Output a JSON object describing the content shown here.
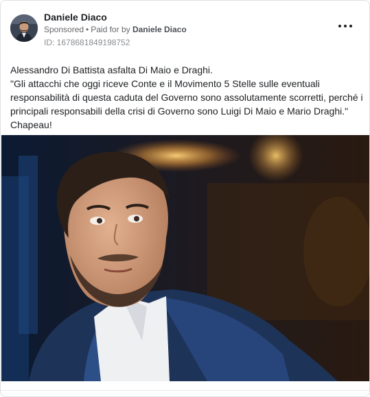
{
  "post": {
    "author": "Daniele Diaco",
    "sponsored_label": "Sponsored",
    "paid_for_prefix": "Paid for by",
    "paid_for_name": "Daniele Diaco",
    "ad_id": "ID: 1678681849198752",
    "text_lines": [
      "Alessandro Di Battista asfalta Di Maio e Draghi.",
      "\"Gli attacchi che oggi riceve Conte e il Movimento 5 Stelle sulle eventuali responsabilità di questa caduta del Governo sono assolutamente scorretti, perché i principali responsabili della crisi di Governo sono Luigi Di Maio e Mario Draghi.\"",
      "Chapeau!"
    ]
  },
  "icons": {
    "more": "more-options-icon",
    "avatar": "avatar-photo"
  },
  "colors": {
    "text": "#1c1e21",
    "meta": "#65676b",
    "photo_background": "#0a1320",
    "stage_light": "#f2b45a"
  }
}
